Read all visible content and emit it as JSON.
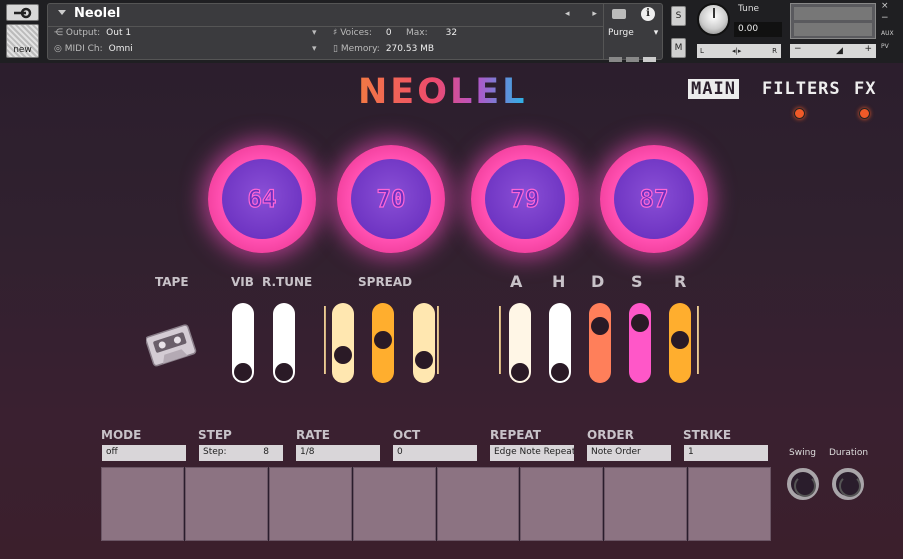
{
  "header": {
    "instrument_name": "Neolel",
    "output_label": "Output:",
    "output_value": "Out 1",
    "midi_label": "MIDI Ch:",
    "midi_value": "Omni",
    "voices_label": "Voices:",
    "voices_value": "0",
    "max_label": "Max:",
    "max_value": "32",
    "memory_label": "Memory:",
    "memory_value": "270.53 MB",
    "purge_label": "Purge",
    "new_label": "new",
    "solo_label": "S",
    "mute_label": "M",
    "tune_label": "Tune",
    "tune_value": "0.00",
    "pan_left": "L",
    "pan_center": "◂|▸",
    "pan_right": "R",
    "vol_minus": "−",
    "vol_plus": "+",
    "close_glyph": "×",
    "min_glyph": "−",
    "aux_label": "AUX",
    "pv_label": "PV",
    "info_glyph": "i",
    "nav_arrows": "◂ ▸"
  },
  "logo": "NEOLEL",
  "nav": {
    "tabs": [
      {
        "label": "MAIN",
        "active": true
      },
      {
        "label": "FILTERS",
        "active": false
      },
      {
        "label": "FX",
        "active": false
      }
    ]
  },
  "knobs": [
    {
      "value": "64"
    },
    {
      "value": "70"
    },
    {
      "value": "79"
    },
    {
      "value": "87"
    }
  ],
  "labels": {
    "tape": "TAPE",
    "vib": "VIB",
    "rtune": "R.TUNE",
    "spread": "SPREAD",
    "a": "A",
    "h": "H",
    "d": "D",
    "s": "S",
    "r": "R"
  },
  "sliders": [
    {
      "name": "vib",
      "color": "#ffffff",
      "level": 0.0
    },
    {
      "name": "rtune",
      "color": "#ffffff",
      "level": 0.0
    },
    {
      "name": "spread-1",
      "color": "#ffe7b0",
      "level": 0.3
    },
    {
      "name": "spread-2",
      "color": "#ffae2e",
      "level": 0.55
    },
    {
      "name": "spread-3",
      "color": "#ffe7b0",
      "level": 0.2
    },
    {
      "name": "attack",
      "color": "#fff6e6",
      "level": 0.0
    },
    {
      "name": "hold",
      "color": "#ffffff",
      "level": 0.0
    },
    {
      "name": "decay",
      "color": "#ff7f5a",
      "level": 0.8
    },
    {
      "name": "sustain",
      "color": "#ff57c8",
      "level": 0.85
    },
    {
      "name": "release",
      "color": "#ffae2e",
      "level": 0.55
    }
  ],
  "sequencer": {
    "mode_label": "MODE",
    "mode_value": "off",
    "step_label": "STEP",
    "step_value_label": "Step:",
    "step_value": "8",
    "rate_label": "RATE",
    "rate_value": "1/8",
    "oct_label": "OCT",
    "oct_value": "0",
    "repeat_label": "REPEAT",
    "repeat_value": "Edge Note Repeat",
    "order_label": "ORDER",
    "order_value": "Note Order",
    "strike_label": "STRIKE",
    "strike_value": "1",
    "swing_label": "Swing",
    "duration_label": "Duration"
  }
}
